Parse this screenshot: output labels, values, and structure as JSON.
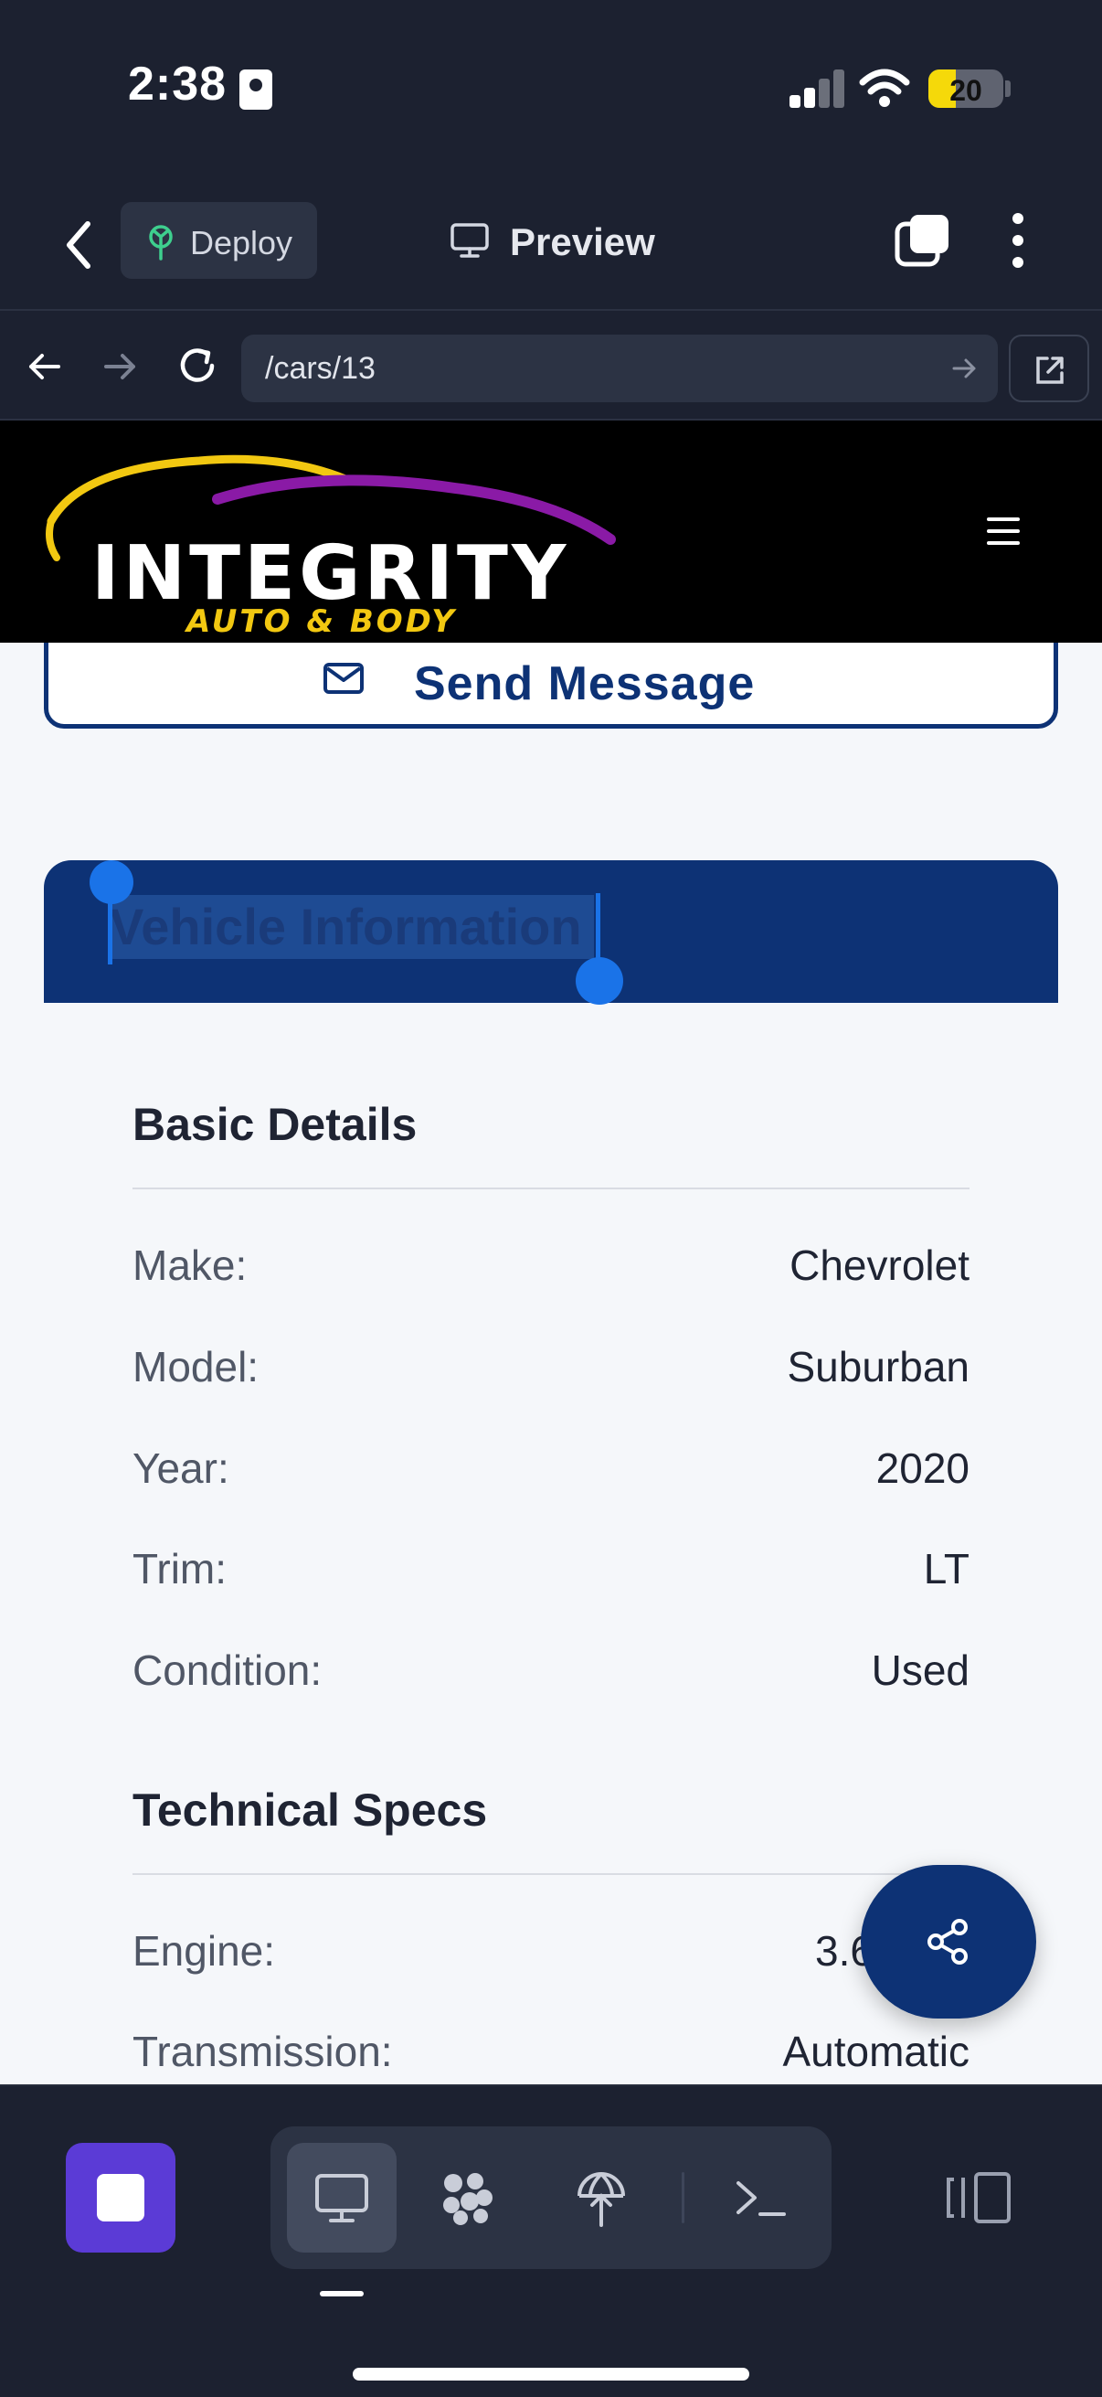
{
  "status_bar": {
    "time": "2:38",
    "battery_level": "20",
    "battery_percent": 20
  },
  "app_header": {
    "deploy_label": "Deploy",
    "preview_label": "Preview"
  },
  "browser": {
    "url": "/cars/13"
  },
  "site": {
    "logo_text": "INTEGRITY",
    "logo_subtext": "AUTO & BODY",
    "logo_colors": {
      "yellow": "#f2c811",
      "purple": "#8a1aa6"
    }
  },
  "page": {
    "send_message_label": "Send Message",
    "vehicle_info_title": "Vehicle Information",
    "basic_details": {
      "title": "Basic Details",
      "rows": [
        {
          "label": "Make:",
          "value": "Chevrolet"
        },
        {
          "label": "Model:",
          "value": "Suburban"
        },
        {
          "label": "Year:",
          "value": "2020"
        },
        {
          "label": "Trim:",
          "value": "LT"
        },
        {
          "label": "Condition:",
          "value": "Used"
        }
      ]
    },
    "technical_specs": {
      "title": "Technical Specs",
      "rows": [
        {
          "label": "Engine:",
          "value": "3.6"
        },
        {
          "label": "Transmission:",
          "value": "Automatic"
        }
      ]
    }
  },
  "bottom_toolbar": {
    "tools": [
      "preview-icon",
      "extensions-icon",
      "deploy-icon",
      "terminal-icon"
    ],
    "active_tool": "preview-icon"
  },
  "colors": {
    "app_bg": "#1c2130",
    "brand_navy": "#0d3275",
    "accent_blue": "#1a73e8",
    "stop_purple": "#5b3bd6"
  }
}
